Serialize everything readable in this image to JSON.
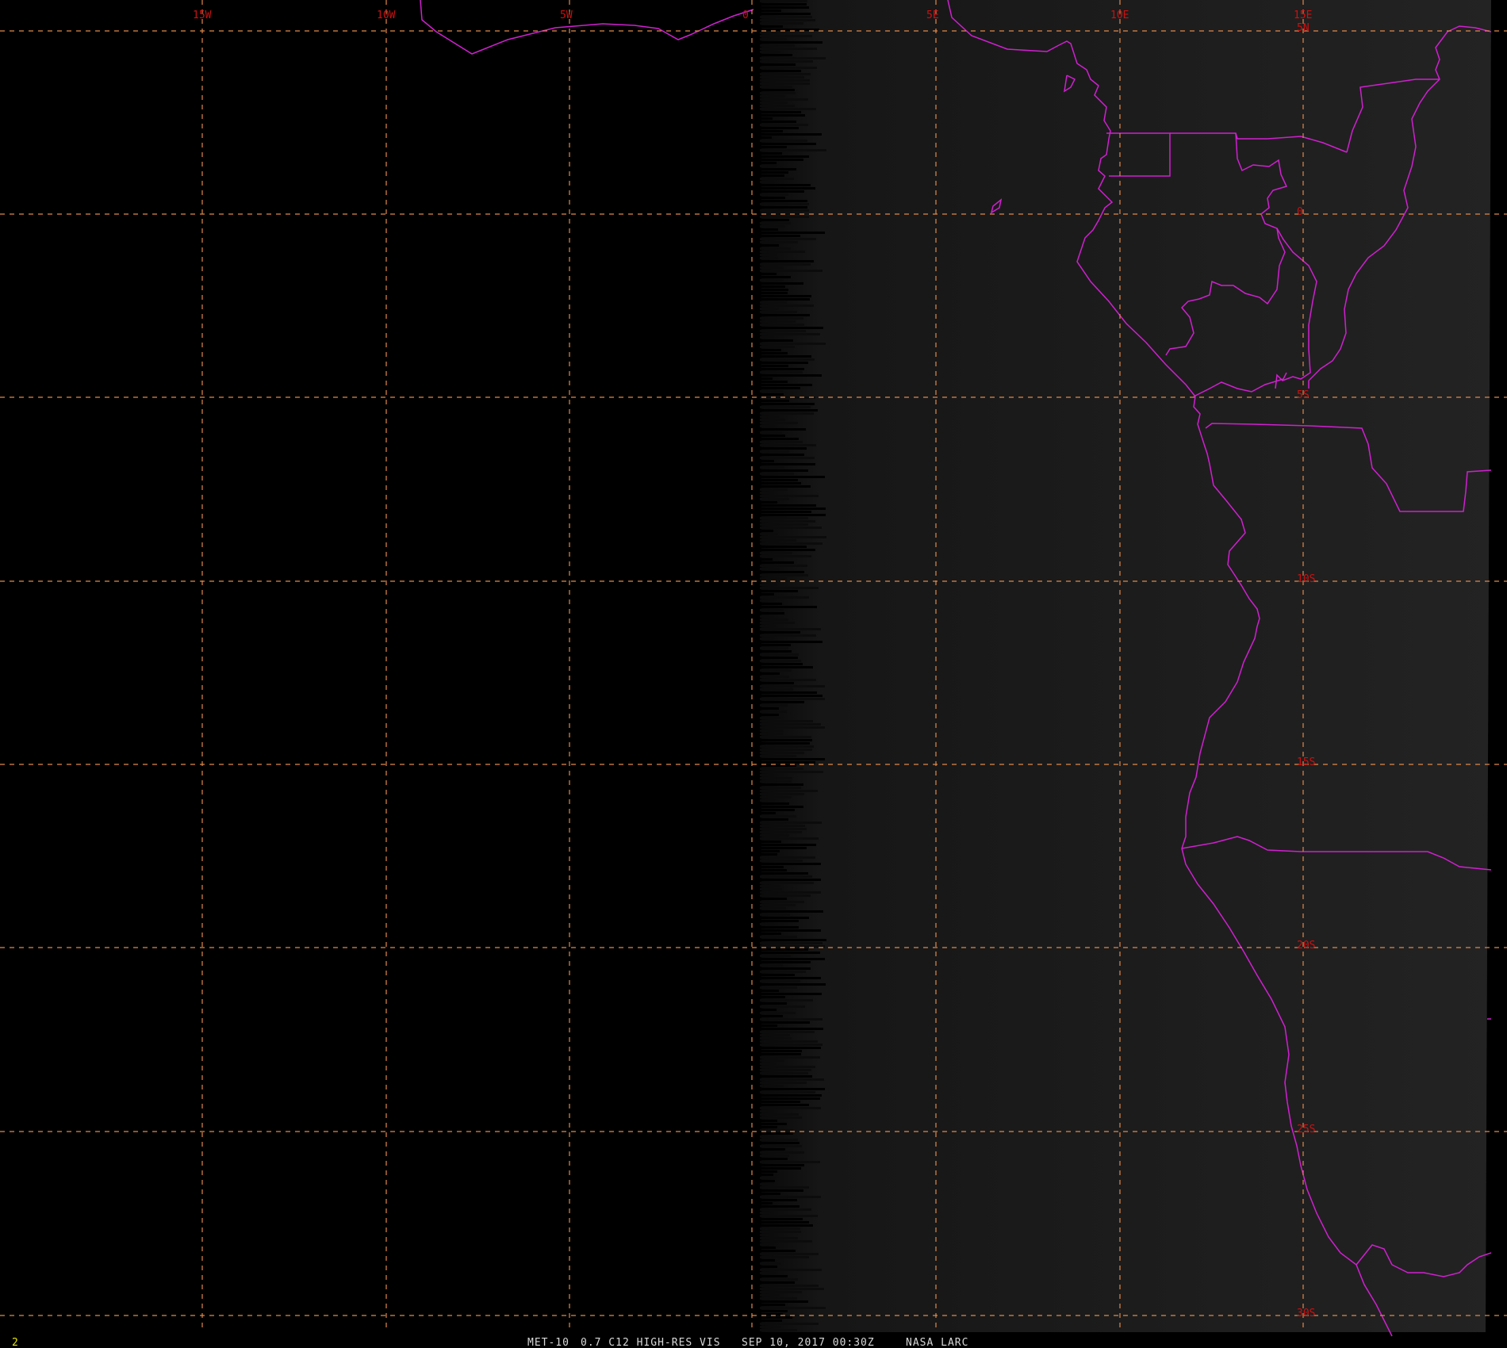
{
  "product": {
    "satellite": "MET-10",
    "channel": "0.7 C12 HIGH-RES VIS",
    "datetime": "SEP 10, 2017 00:30Z",
    "source": "NASA LARC",
    "frame_number": "2"
  },
  "grid": {
    "longitude_labels": [
      "15W",
      "10W",
      "5W",
      "0",
      "5E",
      "10E",
      "15E"
    ],
    "latitude_labels": [
      "5N",
      "0",
      "5S",
      "10S",
      "15S",
      "20S",
      "25S",
      "30S"
    ]
  },
  "colors": {
    "background": "#000000",
    "image_lit": "#1e1e1e",
    "gridlines": "#e0894a",
    "coastlines": "#d020d0",
    "grid_labels": "#cc1111",
    "status_text": "#d8d8d8",
    "frame_number": "#e6e600"
  }
}
